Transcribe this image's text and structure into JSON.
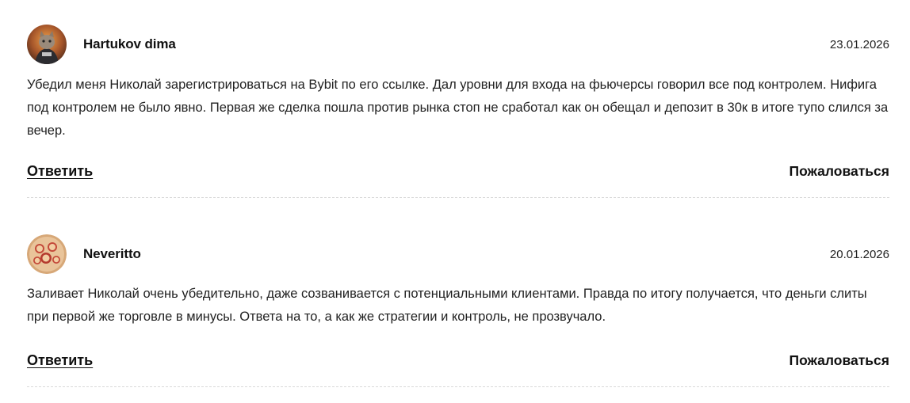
{
  "comments": [
    {
      "author": "Hartukov dima",
      "date": "23.01.2026",
      "text": "Убедил меня Николай зарегистрироваться на Bybit по его ссылке. Дал уровни для входа на фьючерсы говорил все под контролем. Нифига под контролем не было явно. Первая же сделка пошла против рынка стоп не сработал как он обещал и депозит в 30к в итоге тупо слился за вечер.",
      "reply_label": "Ответить",
      "report_label": "Пожаловаться"
    },
    {
      "author": "Neveritto",
      "date": "20.01.2026",
      "text": "Заливает Николай очень убедительно, даже созванивается с потенциальными клиентами. Правда по итогу получается, что деньги слиты при первой же торговле в минусы. Ответа на то, а как же стратегии и контроль, не прозвучало.",
      "reply_label": "Ответить",
      "report_label": "Пожаловаться"
    }
  ],
  "icons": {
    "avatar_1": "cat-avatar-icon",
    "avatar_2": "group-photo-avatar-icon"
  }
}
